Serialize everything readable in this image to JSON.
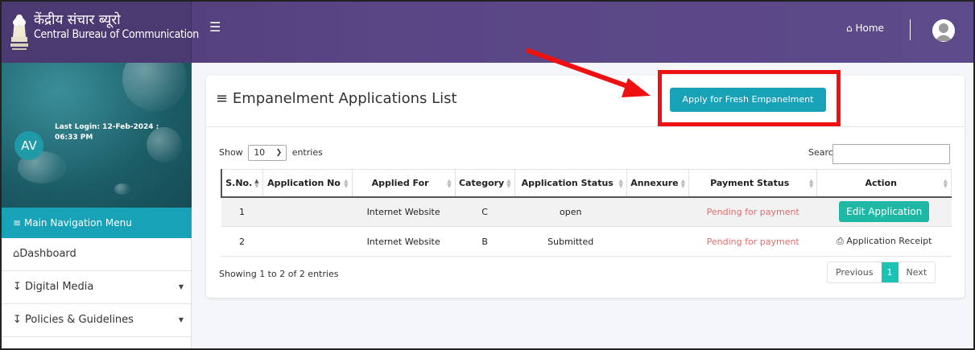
{
  "header": {
    "brand_hindi": "केंद्रीय संचार ब्यूरो",
    "brand_english": "Central Bureau of Communication",
    "menu_icon": "hamburger-icon",
    "home_label": "Home",
    "home_icon": "home-icon"
  },
  "user": {
    "initials": "AV",
    "last_login": "Last Login: 12-Feb-2024 : 06:33 PM"
  },
  "sidebar": {
    "main_nav_label": "Main Navigation Menu",
    "items": [
      {
        "label": "Dashboard",
        "icon": "home-icon"
      },
      {
        "label": "Digital Media",
        "icon": "arrow-down-icon"
      },
      {
        "label": "Policies & Guidelines",
        "icon": "arrow-down-icon"
      }
    ]
  },
  "page": {
    "title": "Empanelment Applications List",
    "apply_button": "Apply for Fresh Empanelment",
    "show_label": "Show",
    "entries_value": "10",
    "entries_label": "entries",
    "search_label": "Search:",
    "info": "Showing 1 to 2 of 2 entries"
  },
  "table": {
    "headers": [
      "S.No.",
      "Application No",
      "Applied For",
      "Category",
      "Application Status",
      "Annexure",
      "Payment Status",
      "Action"
    ],
    "rows": [
      {
        "sno": "1",
        "app_no": "",
        "applied_for": "Internet Website",
        "category": "C",
        "status": "open",
        "annexure": "",
        "payment": "Pending for payment",
        "action": "Edit Application"
      },
      {
        "sno": "2",
        "app_no": "",
        "applied_for": "Internet Website",
        "category": "B",
        "status": "Submitted",
        "annexure": "",
        "payment": "Pending for payment",
        "action": "Application Receipt"
      }
    ]
  },
  "pagination": {
    "previous": "Previous",
    "current": "1",
    "next": "Next"
  },
  "colors": {
    "header": "#5a4685",
    "accent": "#17a2b8",
    "edit_button": "#1fb8a4",
    "pending": "#e46a6a",
    "highlight": "#ee1111"
  }
}
